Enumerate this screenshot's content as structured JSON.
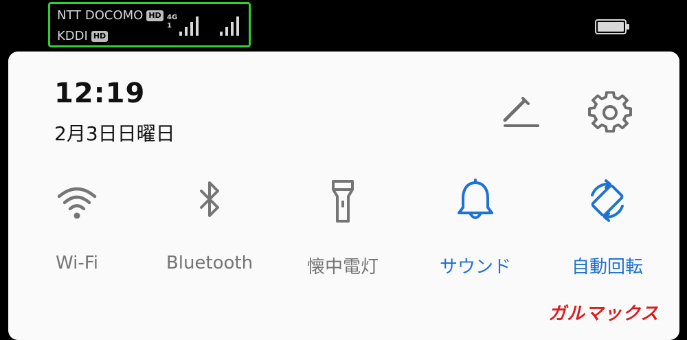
{
  "status_bar": {
    "carrier1": "NTT DOCOMO",
    "carrier2": "KDDI",
    "hd_label": "HD",
    "network_type": "4G",
    "network_sub": "1"
  },
  "header": {
    "time": "12:19",
    "date": "2月3日日曜日"
  },
  "toggles": [
    {
      "label": "Wi-Fi",
      "icon": "wifi-icon",
      "active": false
    },
    {
      "label": "Bluetooth",
      "icon": "bluetooth-icon",
      "active": false
    },
    {
      "label": "懐中電灯",
      "icon": "flashlight-icon",
      "active": false
    },
    {
      "label": "サウンド",
      "icon": "bell-icon",
      "active": true
    },
    {
      "label": "自動回転",
      "icon": "auto-rotate-icon",
      "active": true
    }
  ],
  "colors": {
    "active": "#1e72d2",
    "inactive": "#757575",
    "highlight_box": "#2fd12f"
  },
  "watermark": "ガルマックス"
}
